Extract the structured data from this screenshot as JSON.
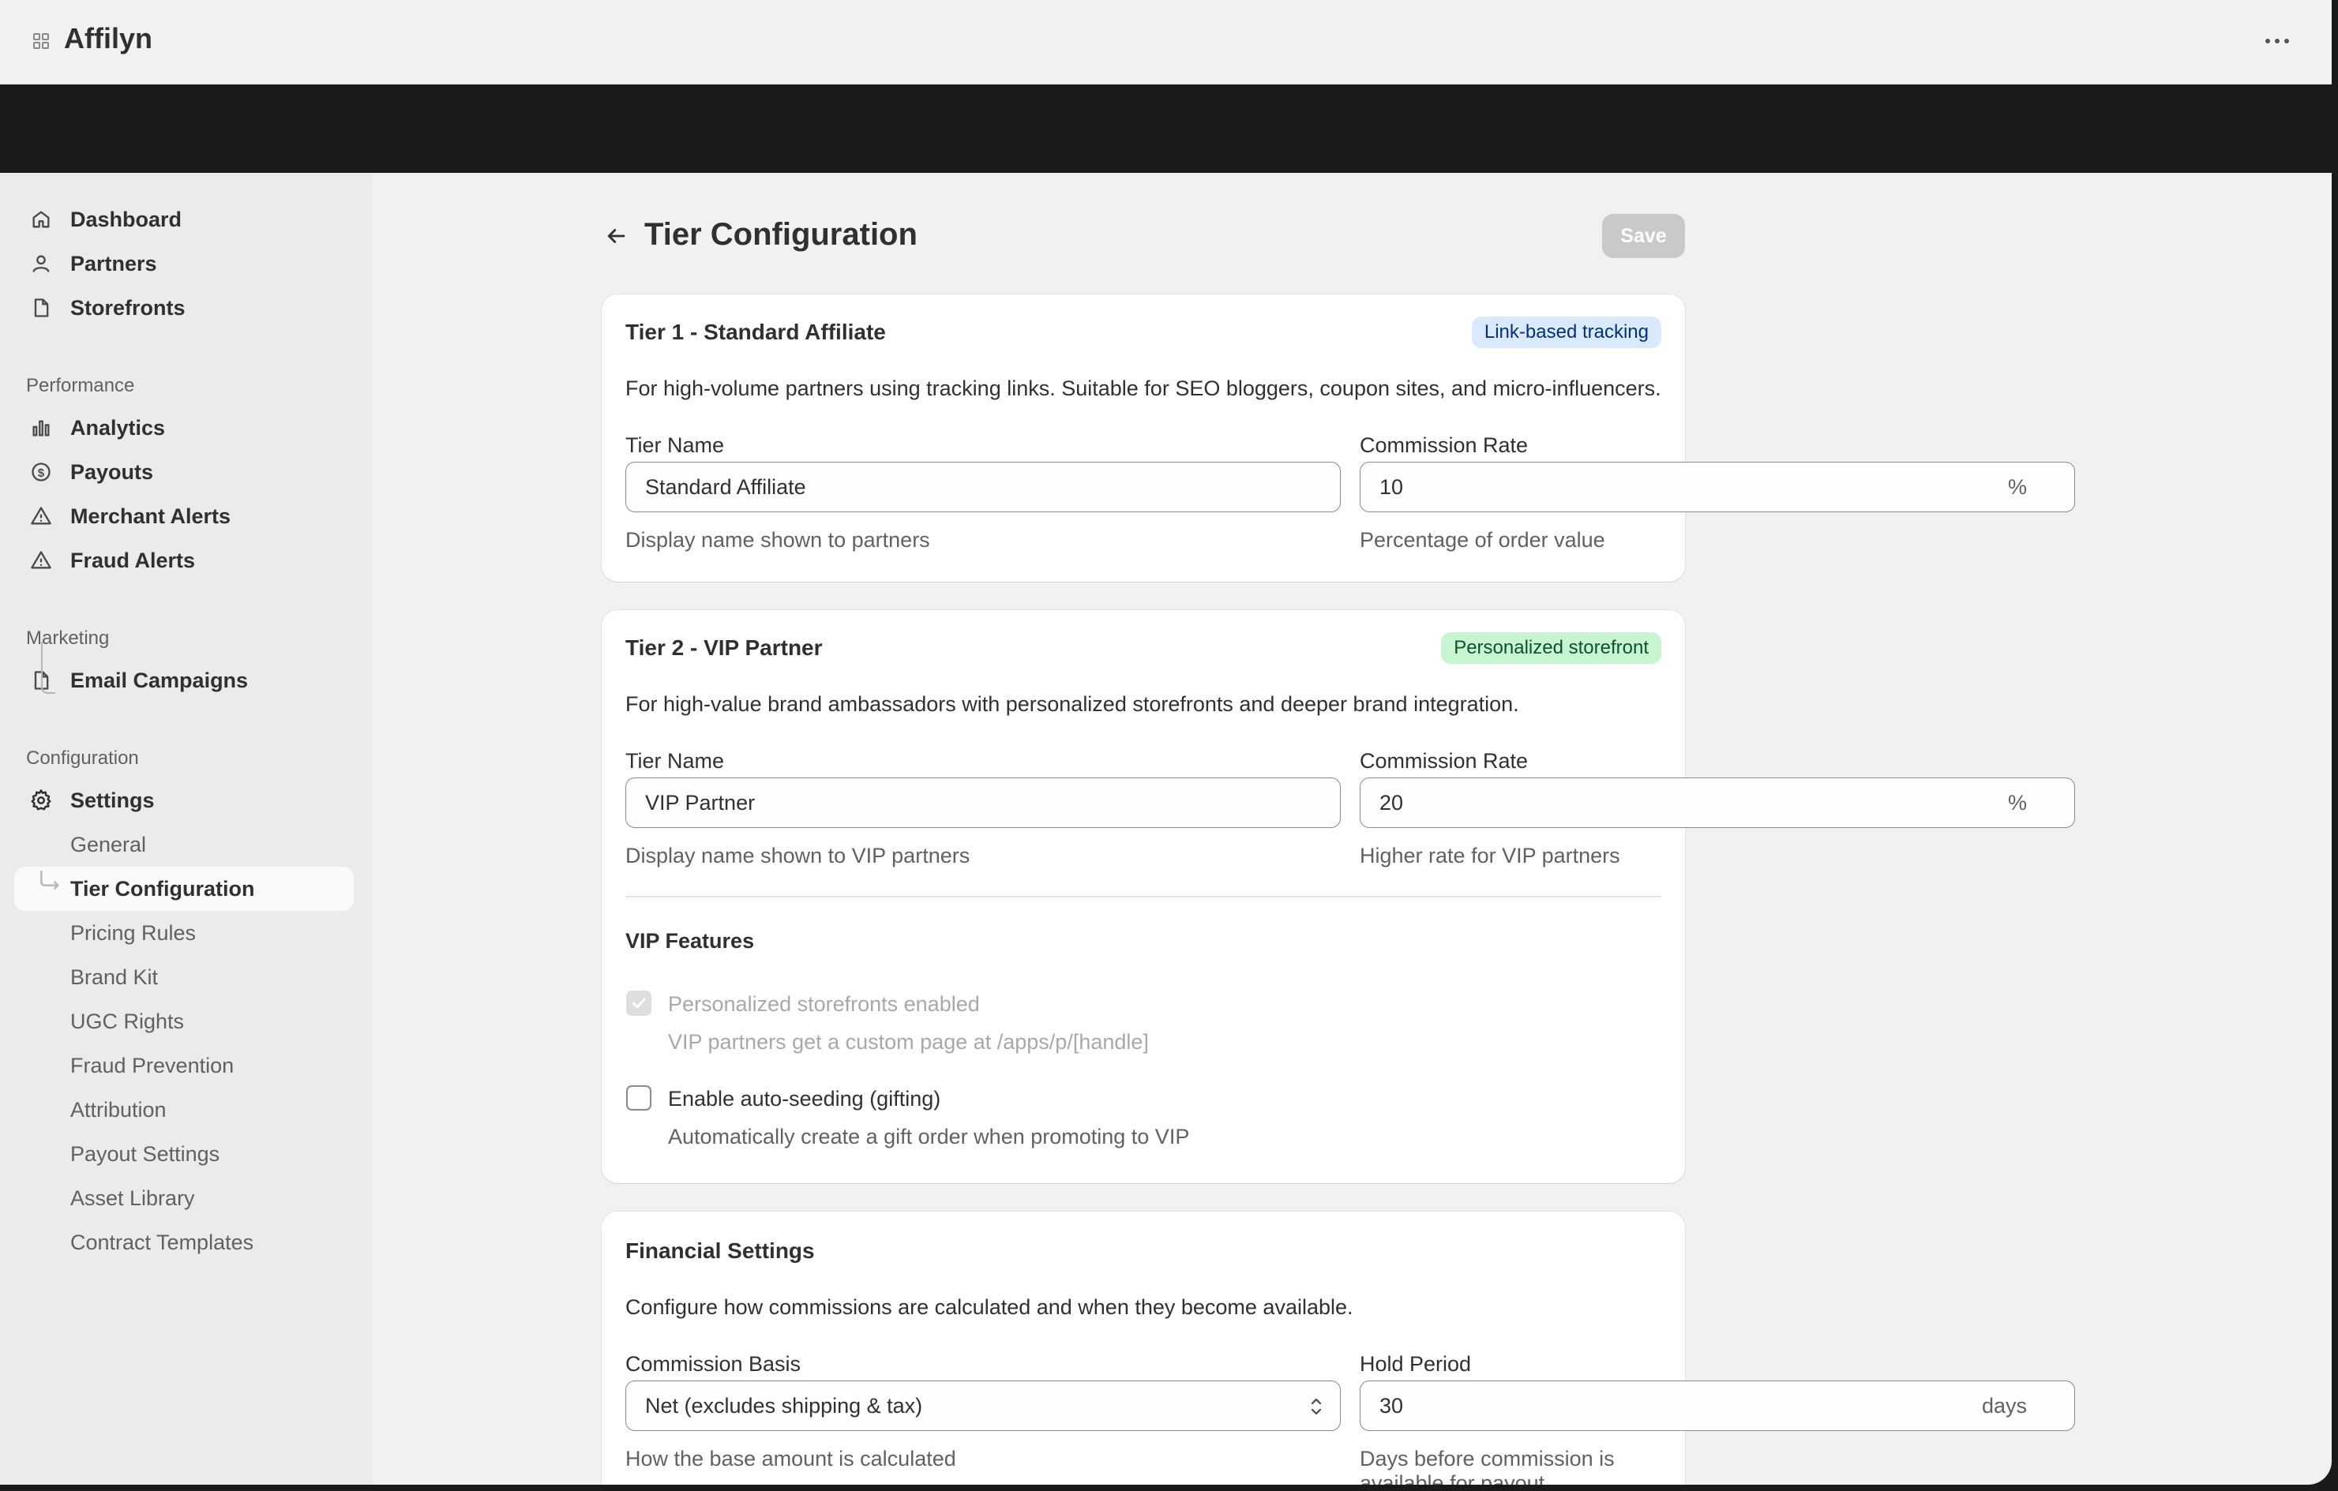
{
  "app": {
    "name": "Affilyn"
  },
  "sidebar": {
    "items": [
      {
        "label": "Dashboard",
        "icon": "home-icon"
      },
      {
        "label": "Partners",
        "icon": "person-icon"
      },
      {
        "label": "Storefronts",
        "icon": "file-icon"
      }
    ],
    "performance_label": "Performance",
    "performance": [
      {
        "label": "Analytics",
        "icon": "bar-chart-icon"
      },
      {
        "label": "Payouts",
        "icon": "dollar-icon"
      },
      {
        "label": "Merchant Alerts",
        "icon": "alert-triangle-icon"
      },
      {
        "label": "Fraud Alerts",
        "icon": "alert-triangle-icon"
      }
    ],
    "marketing_label": "Marketing",
    "marketing": [
      {
        "label": "Email Campaigns",
        "icon": "file-icon"
      }
    ],
    "configuration_label": "Configuration",
    "settings_label": "Settings",
    "settings_sub": [
      "General",
      "Tier Configuration",
      "Pricing Rules",
      "Brand Kit",
      "UGC Rights",
      "Fraud Prevention",
      "Attribution",
      "Payout Settings",
      "Asset Library",
      "Contract Templates"
    ]
  },
  "page": {
    "title": "Tier Configuration",
    "save_label": "Save"
  },
  "tier1": {
    "title": "Tier 1 - Standard Affiliate",
    "badge": "Link-based tracking",
    "description": "For high-volume partners using tracking links. Suitable for SEO bloggers, coupon sites, and micro-influencers.",
    "name_label": "Tier Name",
    "name_value": "Standard Affiliate",
    "name_help": "Display name shown to partners",
    "rate_label": "Commission Rate",
    "rate_value": "10",
    "rate_suffix": "%",
    "rate_help": "Percentage of order value"
  },
  "tier2": {
    "title": "Tier 2 - VIP Partner",
    "badge": "Personalized storefront",
    "description": "For high-value brand ambassadors with personalized storefronts and deeper brand integration.",
    "name_label": "Tier Name",
    "name_value": "VIP Partner",
    "name_help": "Display name shown to VIP partners",
    "rate_label": "Commission Rate",
    "rate_value": "20",
    "rate_suffix": "%",
    "rate_help": "Higher rate for VIP partners",
    "features_title": "VIP Features",
    "feature1_label": "Personalized storefronts enabled",
    "feature1_help": "VIP partners get a custom page at /apps/p/[handle]",
    "feature1_checked": true,
    "feature2_label": "Enable auto-seeding (gifting)",
    "feature2_help": "Automatically create a gift order when promoting to VIP",
    "feature2_checked": false
  },
  "financial": {
    "title": "Financial Settings",
    "description": "Configure how commissions are calculated and when they become available.",
    "basis_label": "Commission Basis",
    "basis_value": "Net (excludes shipping & tax)",
    "basis_help": "How the base amount is calculated",
    "hold_label": "Hold Period",
    "hold_value": "30",
    "hold_suffix": "days",
    "hold_help": "Days before commission is available for payout"
  },
  "colors": {
    "badge_blue_bg": "#dbe9ff",
    "badge_green_bg": "#c7f5d0",
    "save_disabled": "#c9c9c9"
  }
}
